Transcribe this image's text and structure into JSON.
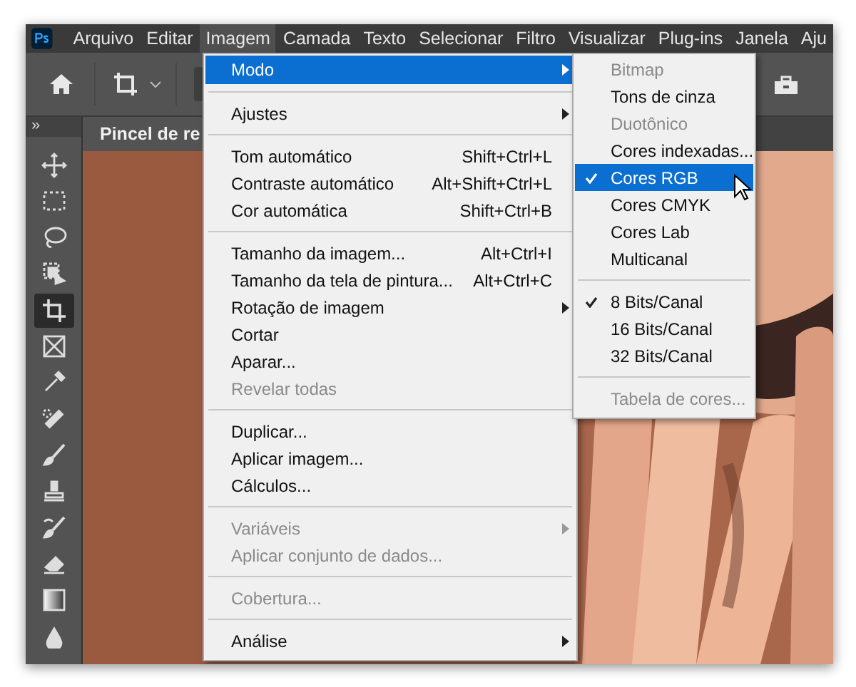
{
  "menubar": [
    {
      "label": "Arquivo",
      "selected": false
    },
    {
      "label": "Editar",
      "selected": false
    },
    {
      "label": "Imagem",
      "selected": true
    },
    {
      "label": "Camada",
      "selected": false
    },
    {
      "label": "Texto",
      "selected": false
    },
    {
      "label": "Selecionar",
      "selected": false
    },
    {
      "label": "Filtro",
      "selected": false
    },
    {
      "label": "Visualizar",
      "selected": false
    },
    {
      "label": "Plug-ins",
      "selected": false
    },
    {
      "label": "Janela",
      "selected": false
    },
    {
      "label": "Aju",
      "selected": false
    }
  ],
  "document_tab": {
    "title": "Pincel de re"
  },
  "tool_panel": {
    "collapse_toggle": "»"
  },
  "tools": [
    {
      "kind": "move",
      "selected": false
    },
    {
      "kind": "marquee",
      "selected": false
    },
    {
      "kind": "lasso",
      "selected": false
    },
    {
      "kind": "select",
      "selected": false
    },
    {
      "kind": "crop",
      "selected": true
    },
    {
      "kind": "frame",
      "selected": false
    },
    {
      "kind": "eyedropper",
      "selected": false
    },
    {
      "kind": "bandage",
      "selected": false
    },
    {
      "kind": "brush",
      "selected": false
    },
    {
      "kind": "stamp",
      "selected": false
    },
    {
      "kind": "history",
      "selected": false
    },
    {
      "kind": "eraser",
      "selected": false
    },
    {
      "kind": "gradient",
      "selected": false
    },
    {
      "kind": "drop",
      "selected": false
    }
  ],
  "image_menu": {
    "groups": [
      [
        {
          "label": "Modo",
          "submenu": true,
          "disabled": false,
          "selected": true
        }
      ],
      [
        {
          "label": "Ajustes",
          "submenu": true,
          "disabled": false,
          "selected": false
        }
      ],
      [
        {
          "label": "Tom automático",
          "shortcut": "Shift+Ctrl+L",
          "submenu": false,
          "disabled": false,
          "selected": false
        },
        {
          "label": "Contraste automático",
          "shortcut": "Alt+Shift+Ctrl+L",
          "submenu": false,
          "disabled": false,
          "selected": false
        },
        {
          "label": "Cor automática",
          "shortcut": "Shift+Ctrl+B",
          "submenu": false,
          "disabled": false,
          "selected": false
        }
      ],
      [
        {
          "label": "Tamanho da imagem...",
          "shortcut": "Alt+Ctrl+I",
          "submenu": false,
          "disabled": false,
          "selected": false
        },
        {
          "label": "Tamanho da tela de pintura...",
          "shortcut": "Alt+Ctrl+C",
          "submenu": false,
          "disabled": false,
          "selected": false
        },
        {
          "label": "Rotação de imagem",
          "submenu": true,
          "disabled": false,
          "selected": false
        },
        {
          "label": "Cortar",
          "submenu": false,
          "disabled": false,
          "selected": false
        },
        {
          "label": "Aparar...",
          "submenu": false,
          "disabled": false,
          "selected": false
        },
        {
          "label": "Revelar todas",
          "submenu": false,
          "disabled": true,
          "selected": false
        }
      ],
      [
        {
          "label": "Duplicar...",
          "submenu": false,
          "disabled": false,
          "selected": false
        },
        {
          "label": "Aplicar imagem...",
          "submenu": false,
          "disabled": false,
          "selected": false
        },
        {
          "label": "Cálculos...",
          "submenu": false,
          "disabled": false,
          "selected": false
        }
      ],
      [
        {
          "label": "Variáveis",
          "submenu": true,
          "disabled": true,
          "selected": false
        },
        {
          "label": "Aplicar conjunto de dados...",
          "submenu": false,
          "disabled": true,
          "selected": false
        }
      ],
      [
        {
          "label": "Cobertura...",
          "submenu": false,
          "disabled": true,
          "selected": false
        }
      ],
      [
        {
          "label": "Análise",
          "submenu": true,
          "disabled": false,
          "selected": false
        }
      ]
    ]
  },
  "mode_submenu": {
    "groups": [
      [
        {
          "label": "Bitmap",
          "disabled": true,
          "checked": false,
          "selected": false
        },
        {
          "label": "Tons de cinza",
          "disabled": false,
          "checked": false,
          "selected": false
        },
        {
          "label": "Duotônico",
          "disabled": true,
          "checked": false,
          "selected": false
        },
        {
          "label": "Cores indexadas...",
          "disabled": false,
          "checked": false,
          "selected": false
        },
        {
          "label": "Cores RGB",
          "disabled": false,
          "checked": true,
          "selected": true
        },
        {
          "label": "Cores CMYK",
          "disabled": false,
          "checked": false,
          "selected": false
        },
        {
          "label": "Cores Lab",
          "disabled": false,
          "checked": false,
          "selected": false
        },
        {
          "label": "Multicanal",
          "disabled": false,
          "checked": false,
          "selected": false
        }
      ],
      [
        {
          "label": "8 Bits/Canal",
          "disabled": false,
          "checked": true,
          "selected": false
        },
        {
          "label": "16 Bits/Canal",
          "disabled": false,
          "checked": false,
          "selected": false
        },
        {
          "label": "32 Bits/Canal",
          "disabled": false,
          "checked": false,
          "selected": false
        }
      ],
      [
        {
          "label": "Tabela de cores...",
          "disabled": true,
          "checked": false,
          "selected": false
        }
      ]
    ]
  }
}
